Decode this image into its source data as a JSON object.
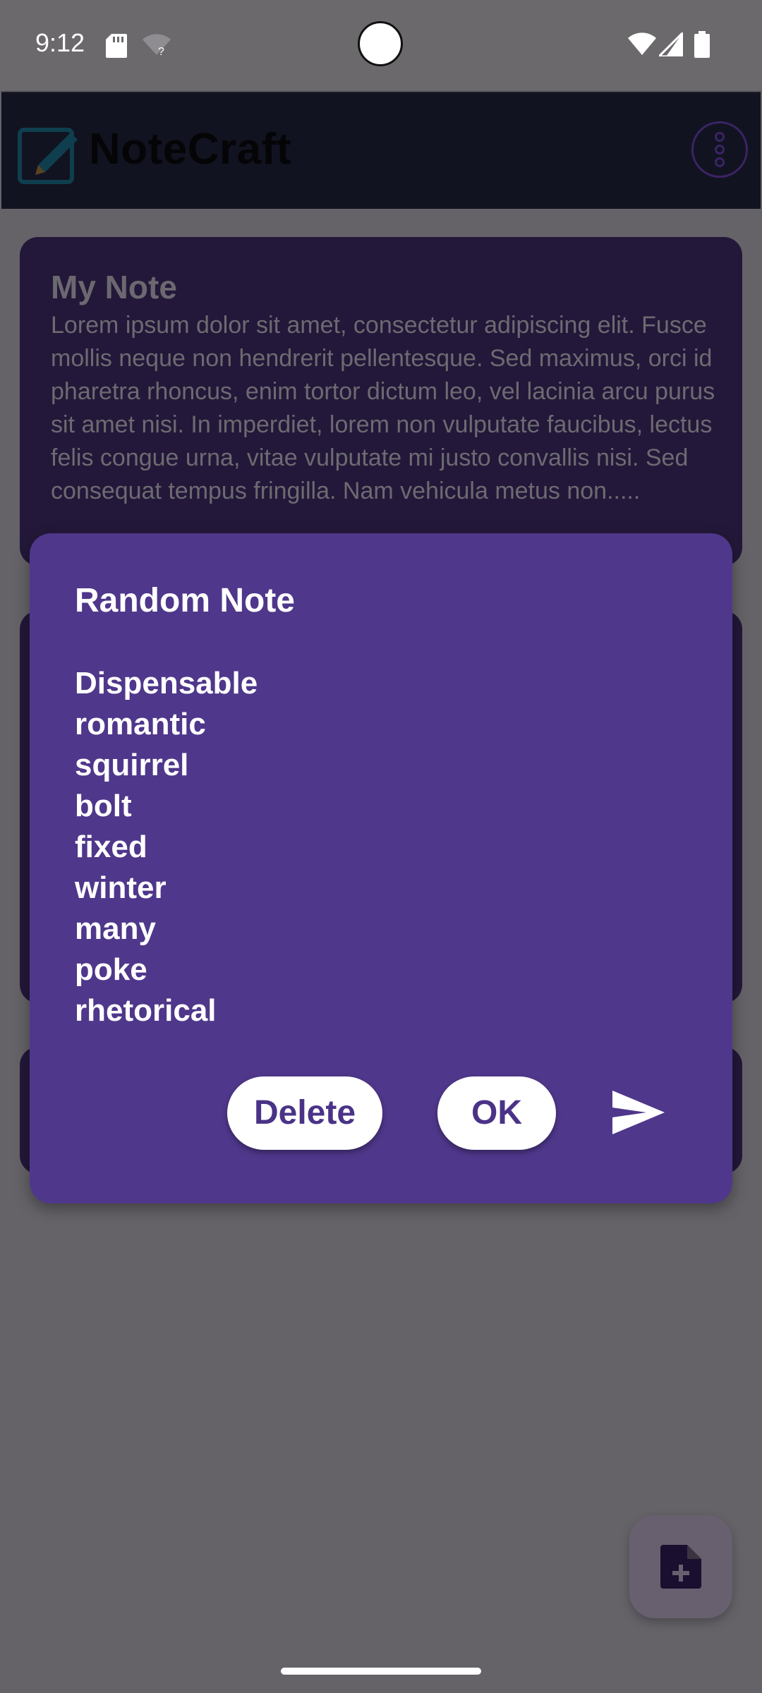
{
  "status_bar": {
    "time": "9:12",
    "icons": [
      "sd-card-icon",
      "wifi-question-icon",
      "wifi-icon",
      "signal-icon",
      "battery-icon"
    ]
  },
  "app_bar": {
    "title": "NoteCraft",
    "logo_icon": "edit-note-icon",
    "menu_icon": "more-vert-icon"
  },
  "background_notes": [
    {
      "title": "My Note",
      "body": "Lorem ipsum dolor sit amet, consectetur adipiscing elit. Fusce mollis neque non hendrerit pellentesque. Sed maximus, orci id pharetra rhoncus, enim tortor dictum leo, vel lacinia arcu purus sit amet nisi. In imperdiet, lorem non vulputate faucibus, lectus felis congue urna, vitae vulputate mi justo convallis nisi. Sed consequat tempus fringilla. Nam vehicula metus non....."
    }
  ],
  "dialog": {
    "title": "Random Note",
    "words": [
      "Dispensable",
      "romantic",
      "squirrel",
      "bolt",
      "fixed",
      "winter",
      "many",
      "poke",
      "rhetorical"
    ],
    "delete_label": "Delete",
    "ok_label": "OK",
    "send_icon": "send-icon"
  },
  "fab": {
    "icon": "add-note-icon"
  },
  "colors": {
    "dialog_bg": "#4f378b",
    "app_bar_bg": "#121320",
    "card_bg": "#231839",
    "scrim": "#656368",
    "button_text": "#4a3387"
  }
}
